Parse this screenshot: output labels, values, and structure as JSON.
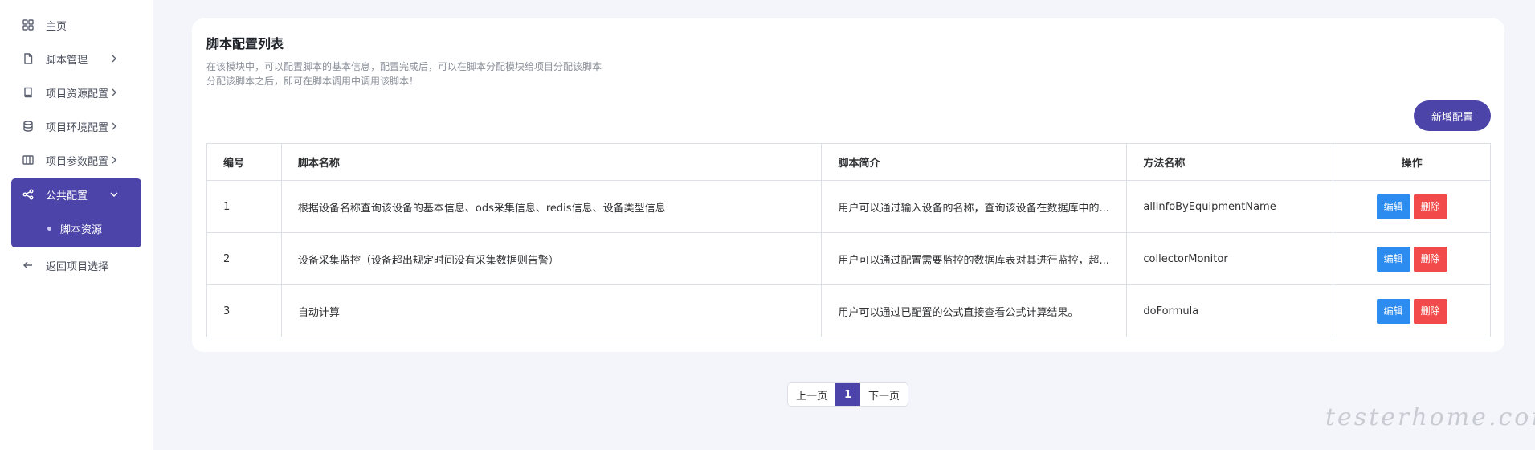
{
  "sidebar": {
    "items": [
      {
        "label": "主页",
        "icon": "grid-icon"
      },
      {
        "label": "脚本管理",
        "icon": "file-icon"
      },
      {
        "label": "项目资源配置",
        "icon": "book-icon"
      },
      {
        "label": "项目环境配置",
        "icon": "database-icon"
      },
      {
        "label": "项目参数配置",
        "icon": "columns-icon"
      },
      {
        "label": "公共配置",
        "icon": "share-icon"
      },
      {
        "label": "返回项目选择",
        "icon": "arrow-left-icon"
      }
    ],
    "active_sub_item": "脚本资源"
  },
  "card": {
    "title": "脚本配置列表",
    "description_line1": "在该模块中，可以配置脚本的基本信息，配置完成后，可以在脚本分配模块给项目分配该脚本",
    "description_line2": "分配该脚本之后，即可在脚本调用中调用该脚本！",
    "add_button": "新增配置"
  },
  "table": {
    "headers": [
      "编号",
      "脚本名称",
      "脚本简介",
      "方法名称",
      "操作"
    ],
    "rows": [
      {
        "id": "1",
        "name": "根据设备名称查询该设备的基本信息、ods采集信息、redis信息、设备类型信息",
        "intro": "用户可以通过输入设备的名称，查询该设备在数据库中的...",
        "method": "allInfoByEquipmentName"
      },
      {
        "id": "2",
        "name": "设备采集监控（设备超出规定时间没有采集数据则告警）",
        "intro": "用户可以通过配置需要监控的数据库表对其进行监控，超...",
        "method": "collectorMonitor"
      },
      {
        "id": "3",
        "name": "自动计算",
        "intro": "用户可以通过已配置的公式直接查看公式计算结果。",
        "method": "doFormula"
      }
    ],
    "edit_label": "编辑",
    "delete_label": "删除"
  },
  "pagination": {
    "prev": "上一页",
    "current": "1",
    "next": "下一页"
  },
  "watermark": "testerhome.com",
  "colors": {
    "primary": "#4c44a8",
    "edit": "#2d8cf0",
    "delete": "#f24a4a",
    "background": "#f3f5fb"
  }
}
